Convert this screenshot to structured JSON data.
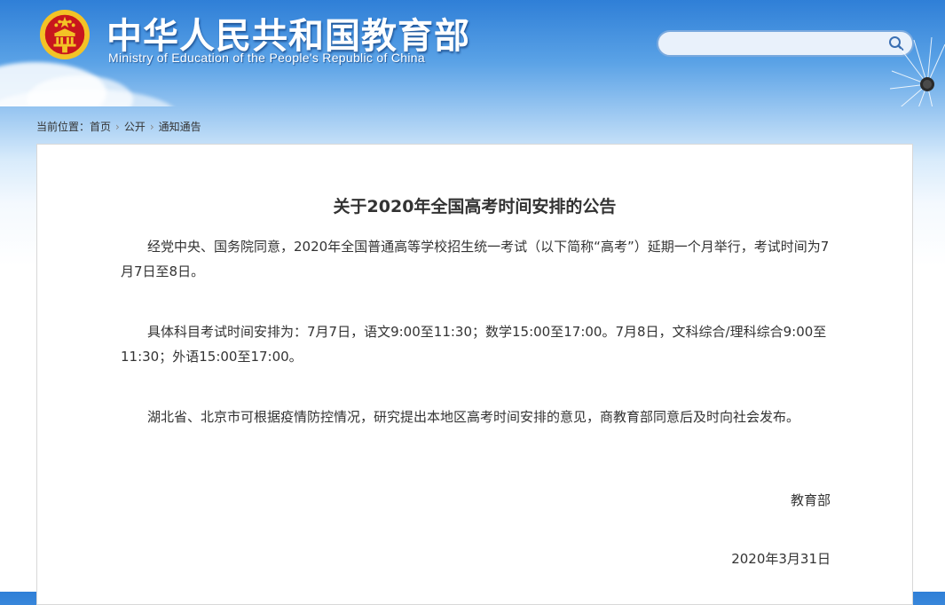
{
  "header": {
    "site_title": "中华人民共和国教育部",
    "site_subtitle": "Ministry of Education of the People's Republic of China",
    "search": {
      "value": "",
      "placeholder": ""
    }
  },
  "icons": {
    "emblem": "national-emblem",
    "search": "search-icon"
  },
  "colors": {
    "banner_blue": "#2f7fd7",
    "emblem_red": "#c8161d",
    "emblem_gold": "#f3c326",
    "text": "#333333"
  },
  "breadcrumb": {
    "prefix": "当前位置：",
    "items": [
      "首页",
      "公开",
      "通知通告"
    ],
    "separator": "›"
  },
  "article": {
    "title": "关于2020年全国高考时间安排的公告",
    "paragraphs": [
      "经党中央、国务院同意，2020年全国普通高等学校招生统一考试（以下简称“高考”）延期一个月举行，考试时间为7月7日至8日。",
      "具体科目考试时间安排为：7月7日，语文9:00至11:30；数学15:00至17:00。7月8日，文科综合/理科综合9:00至11:30；外语15:00至17:00。",
      "湖北省、北京市可根据疫情防控情况，研究提出本地区高考时间安排的意见，商教育部同意后及时向社会发布。"
    ],
    "signature": "教育部",
    "date": "2020年3月31日"
  }
}
